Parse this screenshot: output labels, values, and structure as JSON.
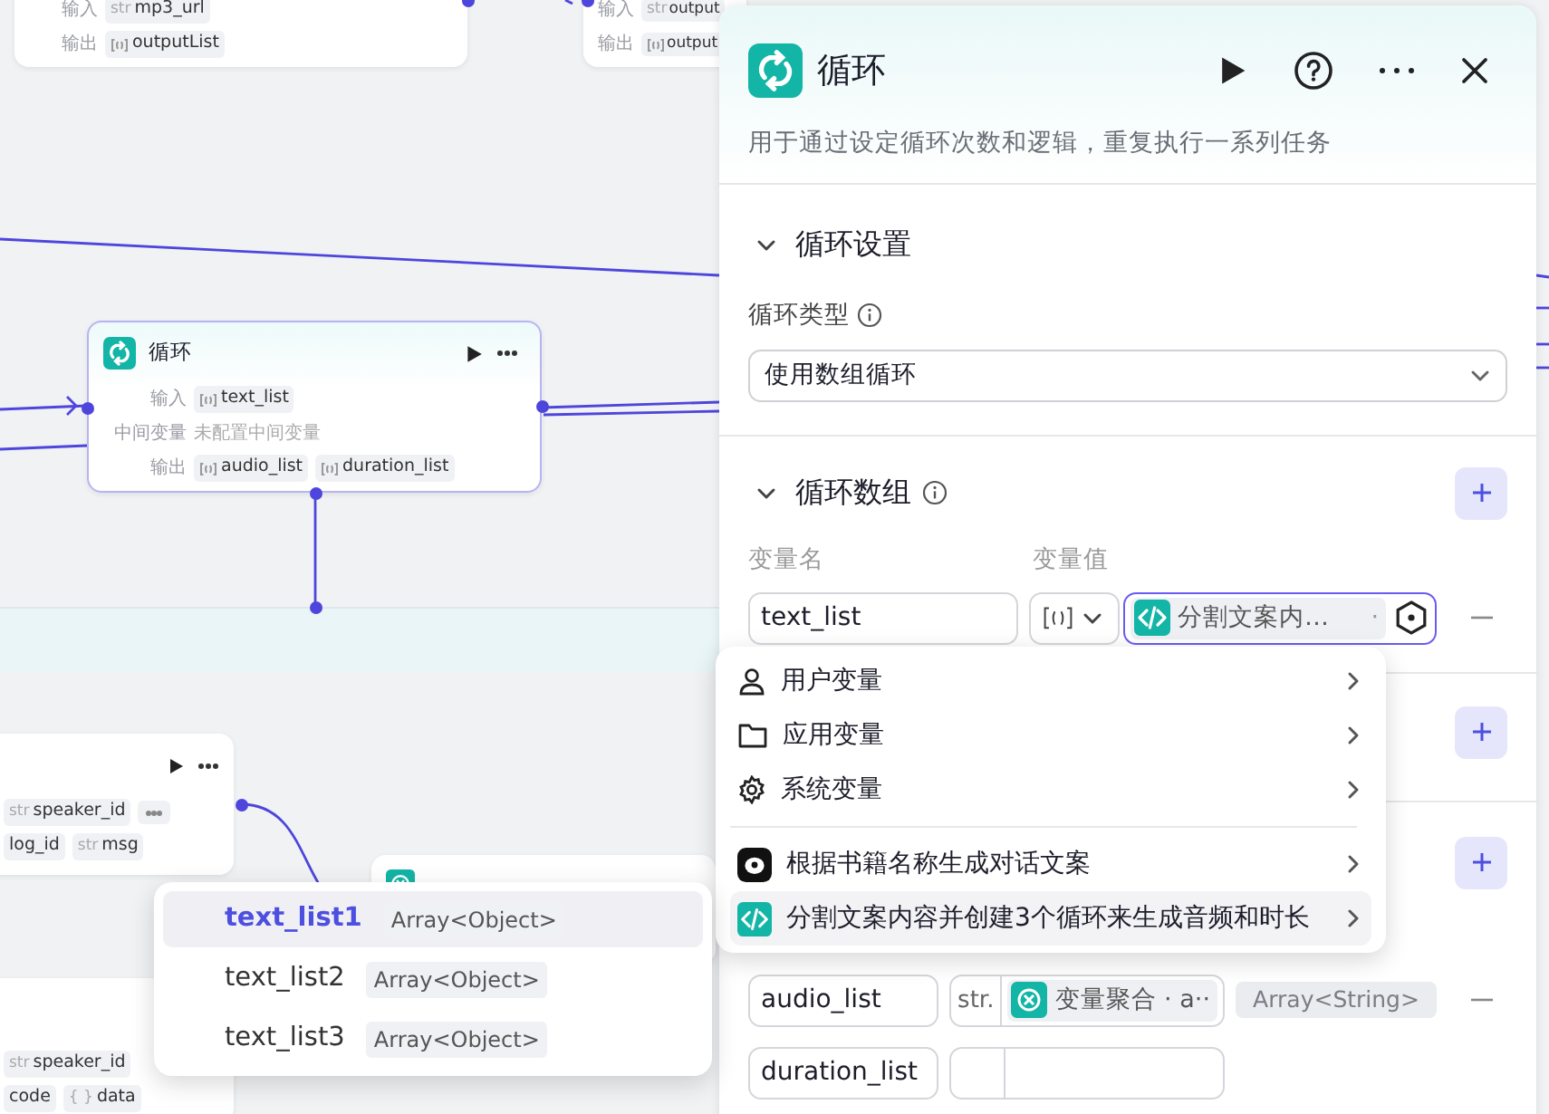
{
  "canvas": {
    "nodes": [
      {
        "kind": "plain",
        "rows": [
          {
            "label": "输入",
            "params": [
              {
                "kind": "string",
                "prefix": "str",
                "name": "mp3_url"
              }
            ]
          },
          {
            "label": "输出",
            "params": [
              {
                "kind": "array",
                "name": "outputList"
              }
            ]
          }
        ]
      },
      {
        "kind": "plain",
        "rows": [
          {
            "label": "输入",
            "params": [
              {
                "kind": "string",
                "prefix": "str",
                "name": "output"
              }
            ]
          },
          {
            "label": "输出",
            "params": [
              {
                "kind": "array",
                "name": "output"
              }
            ]
          }
        ]
      },
      {
        "kind": "titled",
        "title": "循环",
        "rows": [
          {
            "label": "输入",
            "params": [
              {
                "kind": "array",
                "name": "text_list"
              }
            ]
          },
          {
            "label": "中间变量",
            "note": "未配置中间变量"
          },
          {
            "label": "输出",
            "params": [
              {
                "kind": "array",
                "name": "audio_list"
              },
              {
                "kind": "array",
                "name": "duration_list"
              }
            ]
          }
        ]
      },
      {
        "kind": "actions",
        "rows": [
          {
            "params": [
              {
                "kind": "string",
                "prefix": "str",
                "name": "speaker_id"
              },
              {
                "kind": "more"
              }
            ]
          },
          {
            "params": [
              {
                "kind": "plain",
                "name": "log_id"
              },
              {
                "kind": "string",
                "prefix": "str",
                "name": "msg"
              }
            ]
          }
        ]
      },
      {
        "kind": "covered"
      },
      {
        "kind": "plain",
        "rows": [
          {
            "params": [
              {
                "kind": "string",
                "prefix": "str",
                "name": "speaker_id"
              }
            ]
          },
          {
            "params": [
              {
                "kind": "plain",
                "name": "code"
              },
              {
                "kind": "string",
                "prefix": "{ }",
                "name": "data"
              }
            ]
          }
        ]
      }
    ]
  },
  "panel": {
    "title": "循环",
    "description": "用于通过设定循环次数和逻辑，重复执行一系列任务",
    "sections": [
      {
        "kind": "settings",
        "title": "循环设置",
        "expanded": true,
        "field_label": "循环类型",
        "select_value": "使用数组循环"
      },
      {
        "kind": "array",
        "title": "循环数组",
        "expanded": true,
        "columns": [
          "变量名",
          "变量值"
        ],
        "rows": [
          {
            "name": "text_list",
            "ref_text": "分割文案内…",
            "ref_suffix": "·"
          }
        ]
      },
      {
        "kind": "covered"
      },
      {
        "kind": "outputs",
        "rows": [
          {
            "name": "audio_list",
            "type_label": "str.",
            "ref_text": "变量聚合 · a··",
            "badge": "Array<String>"
          },
          {
            "name": "duration_list"
          }
        ]
      }
    ]
  },
  "variable_menu": {
    "groups": [
      {
        "kind": "scopes",
        "items": [
          {
            "label": "用户变量",
            "selected": false
          },
          {
            "label": "应用变量",
            "selected": false
          },
          {
            "label": "系统变量",
            "selected": false
          }
        ]
      },
      {
        "kind": "nodes",
        "items": [
          {
            "label": "根据书籍名称生成对话文案",
            "selected": false
          },
          {
            "label": "分割文案内容并创建3个循环来生成音频和时长",
            "selected": true
          }
        ]
      }
    ]
  },
  "output_menu": {
    "items": [
      {
        "name": "text_list1",
        "type": "Array<Object>",
        "selected": true
      },
      {
        "name": "text_list2",
        "type": "Array<Object>",
        "selected": false
      },
      {
        "name": "text_list3",
        "type": "Array<Object>",
        "selected": false
      }
    ]
  }
}
